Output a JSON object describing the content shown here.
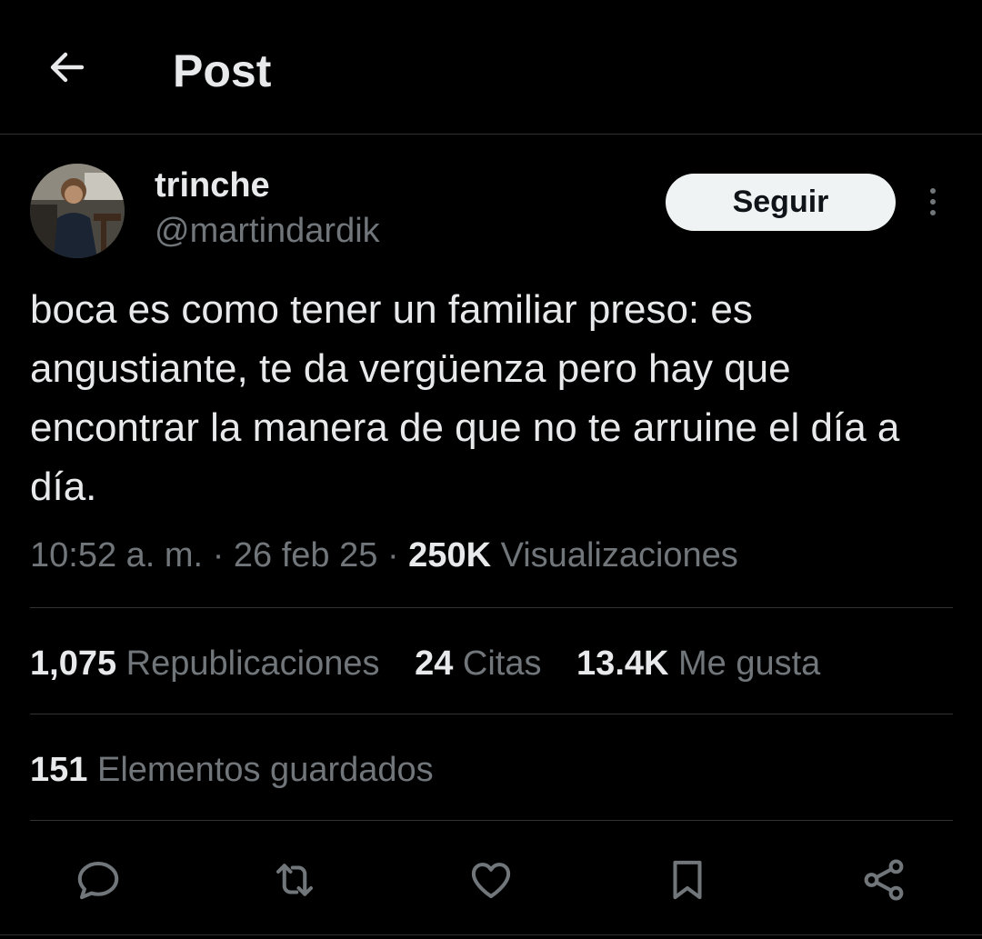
{
  "header": {
    "title": "Post",
    "back_icon": "arrow-left-icon"
  },
  "author": {
    "display_name": "trinche",
    "handle": "@martindardik",
    "follow_label": "Seguir",
    "more_icon": "more-vertical-icon"
  },
  "post": {
    "text": "boca es como tener un familiar preso: es angustiante, te da vergüenza pero hay que encontrar la manera de que no te arruine el día a día."
  },
  "meta": {
    "time": "10:52 a. m.",
    "sep": "·",
    "date": "26 feb 25",
    "views_count": "250K",
    "views_label": "Visualizaciones"
  },
  "stats": {
    "reposts_count": "1,075",
    "reposts_label": "Republicaciones",
    "quotes_count": "24",
    "quotes_label": "Citas",
    "likes_count": "13.4K",
    "likes_label": "Me gusta",
    "bookmarks_count": "151",
    "bookmarks_label": "Elementos guardados"
  },
  "actions": [
    "reply-icon",
    "repost-icon",
    "like-icon",
    "bookmark-icon",
    "share-icon"
  ],
  "colors": {
    "background": "#000000",
    "text_primary": "#e7e9ea",
    "text_secondary": "#71767b",
    "divider": "#2f3336",
    "follow_bg": "#eff3f4",
    "follow_text": "#0f1419"
  }
}
